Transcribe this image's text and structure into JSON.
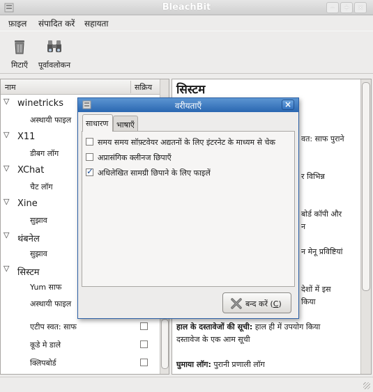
{
  "window": {
    "title": "BleachBit",
    "buttons": [
      "–",
      "+",
      "×"
    ]
  },
  "menubar": {
    "file": {
      "label": "फ़ाइल"
    },
    "edit": {
      "label": "संपादित करें"
    },
    "help": {
      "label": "सहायता"
    }
  },
  "toolbar": {
    "delete_label": "मिटाएँ",
    "preview_label": "पूर्वावलोकन"
  },
  "tree": {
    "col_name": "नाम",
    "col_active": "सक्रिय",
    "rows": [
      {
        "label": "winetricks",
        "type": "parent"
      },
      {
        "label": "अस्थायी फाइल",
        "type": "child"
      },
      {
        "label": "X11",
        "type": "parent"
      },
      {
        "label": "डीबग लॉग",
        "type": "child"
      },
      {
        "label": "XChat",
        "type": "parent"
      },
      {
        "label": "चैट लॉग",
        "type": "child"
      },
      {
        "label": "Xine",
        "type": "parent"
      },
      {
        "label": "सुझाव",
        "type": "child"
      },
      {
        "label": "थंबनेल",
        "type": "parent"
      },
      {
        "label": "सुझाव",
        "type": "child"
      },
      {
        "label": "सिस्टम",
        "type": "parent"
      },
      {
        "label": "Yum साफ",
        "type": "child"
      },
      {
        "label": "अस्थायी फाइल",
        "type": "child"
      },
      {
        "label": "एटीप स्वत: साफ",
        "type": "child",
        "checked": false
      },
      {
        "label": "कूडे मे डाले",
        "type": "child",
        "checked": false
      },
      {
        "label": "क्लिपबोर्ड",
        "type": "child",
        "checked": false
      }
    ]
  },
  "details": {
    "heading": "सिस्टम",
    "fragments": [
      "वत: साफ पुराने",
      "र विभिन्न",
      "बोर्ड कॉपी और",
      "न",
      "न मेनू प्रविष्टियां",
      "देशों में इस",
      "किया"
    ],
    "recent_title": "हाल के दस्तावेजों की सूची:",
    "recent_text_1": "हाल ही में उपयोग किया",
    "recent_text_2": "दस्तावेज के एक आम सूची",
    "rotated_title": "घुमाया लॉग:",
    "rotated_text": "पुरानी प्रणाली लॉग"
  },
  "dialog": {
    "title": "वरीयताएँ",
    "close_glyph": "×",
    "tabs": {
      "general": "साधारण",
      "languages": "भाषाएँ"
    },
    "options": [
      {
        "label": "समय समय सॉफ़्टवेयर अद्यतनों के लिए इंटरनेट के माध्यम से चेक",
        "checked": false
      },
      {
        "label": "अप्रासंगिक क्लीनज छिपाएँ",
        "checked": false
      },
      {
        "label": "अधिलेखित सामग्री छिपाने के लिए फाइलें",
        "checked": true
      }
    ],
    "close_button": {
      "text": "बन्द करें (",
      "mnemonic": "C",
      "suffix": ")"
    }
  }
}
